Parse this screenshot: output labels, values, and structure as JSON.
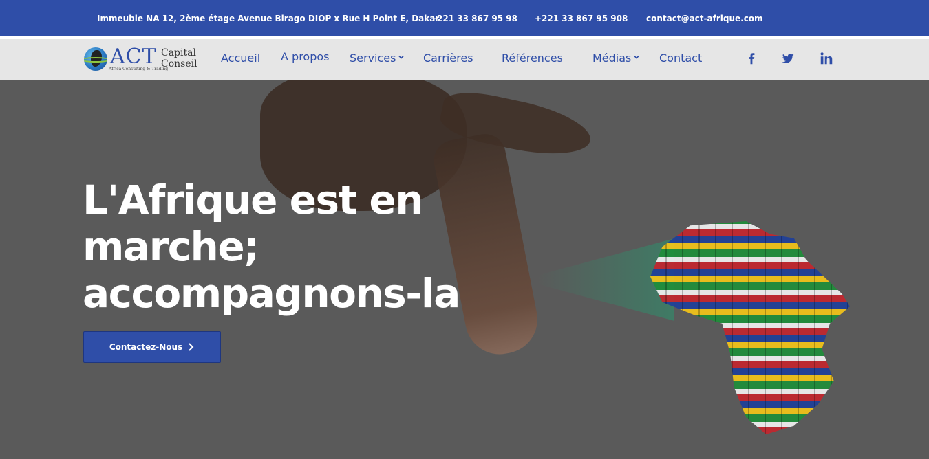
{
  "topbar": {
    "address": "Immeuble NA 12, 2ème étage Avenue Birago DIOP x Rue H Point E, Dakar",
    "phone1": "+221 33 867 95 98",
    "phone2": "+221 33 867 95 908",
    "email": "contact@act-afrique.com"
  },
  "logo": {
    "act": "ACT",
    "capital": "Capital",
    "conseil": "Conseil",
    "tagline": "Africa Consulting & Trading"
  },
  "nav": {
    "items": [
      {
        "label": "Accueil"
      },
      {
        "label": "A propos"
      },
      {
        "label": "Services"
      },
      {
        "label": "Carrières"
      },
      {
        "label": "Références"
      },
      {
        "label": "Médias"
      },
      {
        "label": "Contact"
      }
    ]
  },
  "social": {
    "icons": [
      "facebook-icon",
      "twitter-icon",
      "linkedin-icon"
    ]
  },
  "hero": {
    "headline": "L'Afrique est en marche; accompagnons-la",
    "cta_label": "Contactez-Nous"
  },
  "colors": {
    "brand_blue": "#2f4ea8",
    "nav_bg": "#e6e6e6",
    "hero_overlay": "#5a5a5a"
  }
}
